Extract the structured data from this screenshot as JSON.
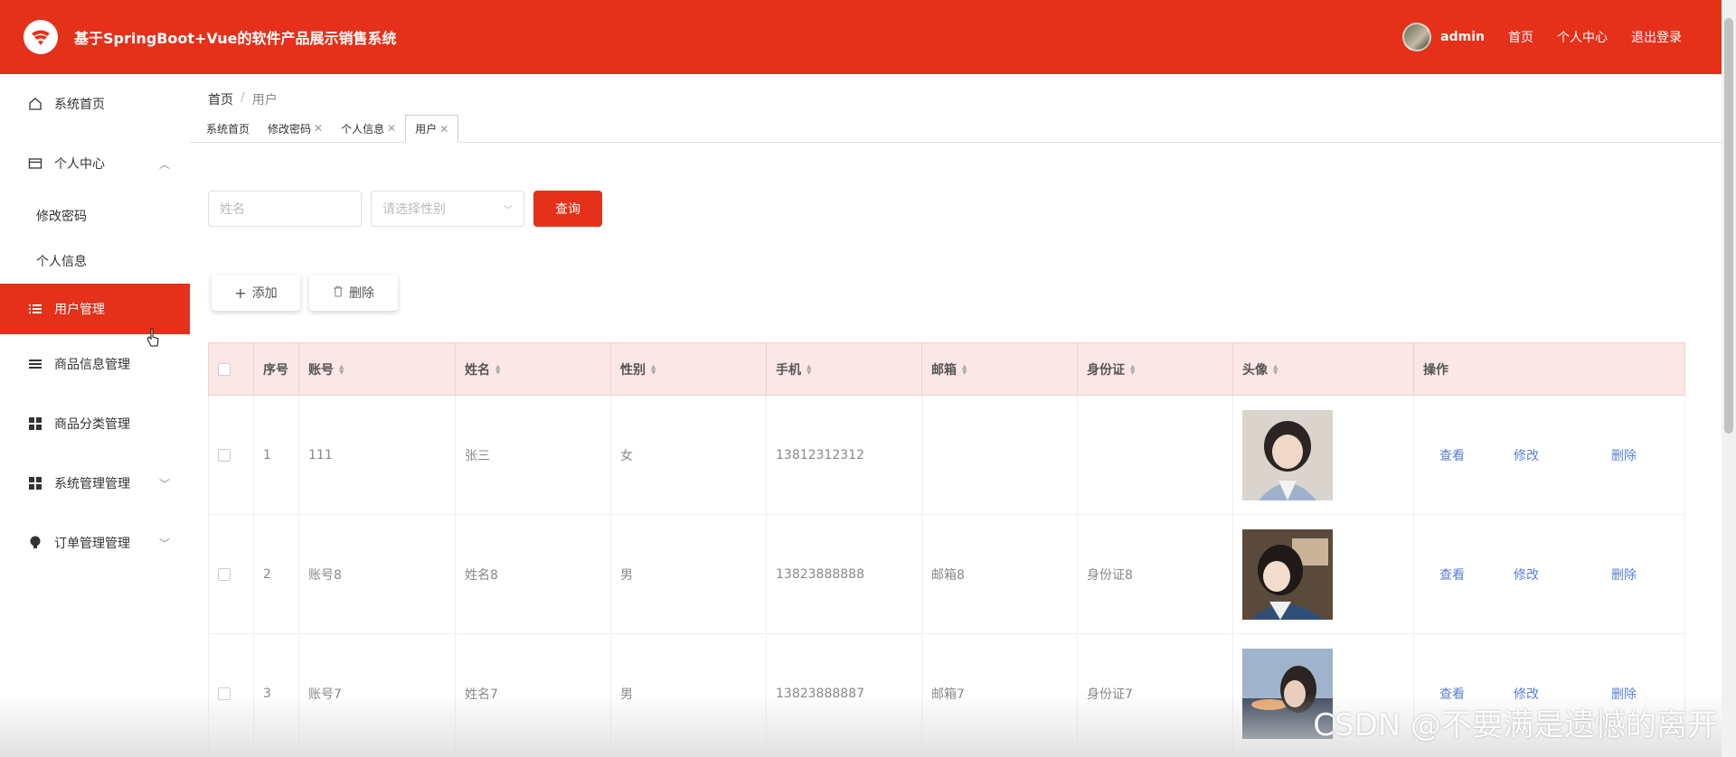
{
  "header": {
    "title": "基于SpringBoot+Vue的软件产品展示销售系统",
    "username": "admin",
    "nav": [
      "首页",
      "个人中心",
      "退出登录"
    ]
  },
  "sidebar": {
    "items": [
      {
        "label": "系统首页",
        "icon": "home-icon"
      },
      {
        "label": "个人中心",
        "icon": "card-icon",
        "expanded": true
      },
      {
        "label": "修改密码",
        "sub": true
      },
      {
        "label": "个人信息",
        "sub": true
      },
      {
        "label": "用户管理",
        "icon": "list-icon",
        "active": true
      },
      {
        "label": "商品信息管理",
        "icon": "list-icon"
      },
      {
        "label": "商品分类管理",
        "icon": "grid-icon"
      },
      {
        "label": "系统管理管理",
        "icon": "grid-icon"
      },
      {
        "label": "订单管理管理",
        "icon": "bulb-icon"
      }
    ]
  },
  "breadcrumb": [
    "首页",
    "/",
    "用户"
  ],
  "tabs": [
    "系统首页",
    "修改密码",
    "个人信息",
    "用户"
  ],
  "search": {
    "name_placeholder": "姓名",
    "gender_placeholder": "请选择性别",
    "query_label": "查询"
  },
  "actions": {
    "add": "添加",
    "delete": "删除"
  },
  "table": {
    "headers": [
      "序号",
      "账号",
      "姓名",
      "性别",
      "手机",
      "邮箱",
      "身份证",
      "头像",
      "操作"
    ],
    "rows": [
      {
        "idx": "1",
        "account": "111",
        "name": "张三",
        "gender": "女",
        "phone": "13812312312",
        "email": "",
        "idcard": ""
      },
      {
        "idx": "2",
        "account": "账号8",
        "name": "姓名8",
        "gender": "男",
        "phone": "13823888888",
        "email": "邮箱8",
        "idcard": "身份证8"
      },
      {
        "idx": "3",
        "account": "账号7",
        "name": "姓名7",
        "gender": "男",
        "phone": "13823888887",
        "email": "邮箱7",
        "idcard": "身份证7"
      }
    ],
    "ops": [
      "查看",
      "修改",
      "删除"
    ]
  },
  "watermark": "CSDN @不要满是遗憾的离开",
  "colors": {
    "primary": "#e5301a",
    "link": "#5a7fd6",
    "header_bg": "#fbe7e6"
  }
}
